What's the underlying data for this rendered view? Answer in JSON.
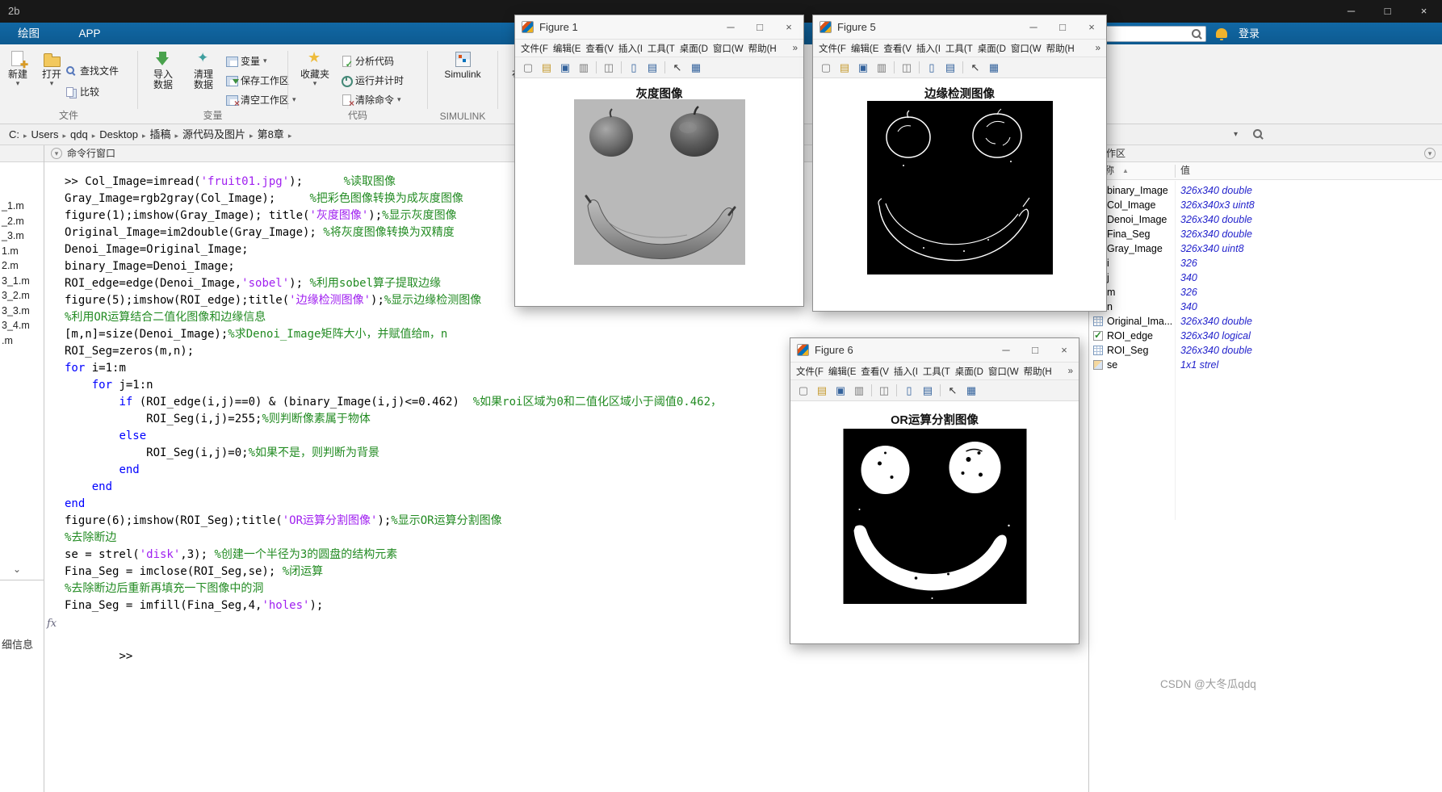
{
  "window": {
    "title": "2b"
  },
  "icons": {
    "minimize": "─",
    "maximize": "□",
    "close": "×",
    "dropdown": "▾",
    "crumb_arrow": "▸",
    "overflow": "»",
    "sort": "▲",
    "collapse": "⌄",
    "fx": "fx",
    "search": "magnifier-css-shape",
    "bell": "bell-css-shape"
  },
  "ribbon_tabs": [
    "绘图",
    "APP"
  ],
  "top_right": {
    "login": "登录"
  },
  "toolstrip": {
    "sections": [
      "文件",
      "变量",
      "代码",
      "SIMULINK"
    ],
    "buttons": {
      "new": "新建",
      "open": "打开",
      "find_files": "查找文件",
      "compare": "比较",
      "import_data": "导入数据",
      "clean_data": "清理数据",
      "variable": "变量",
      "save_workspace": "保存工作区",
      "clear_workspace": "清空工作区",
      "favorites": "收藏夹",
      "analyze_code": "分析代码",
      "run_and_time": "运行并计时",
      "clear_commands": "清除命令",
      "simulink": "Simulink",
      "layout": "布局"
    }
  },
  "addressbar": {
    "crumbs": [
      "C:",
      "Users",
      "qdq",
      "Desktop",
      "插稿",
      "源代码及图片",
      "第8章"
    ]
  },
  "left_panel": {
    "files": [
      "_1.m",
      "_2.m",
      "_3.m",
      "1.m",
      "2.m",
      "3_1.m",
      "3_2.m",
      "3_3.m",
      "3_4.m",
      ".m"
    ],
    "details": "细信息"
  },
  "command_window": {
    "title": "命令行窗口",
    "prompt": ">>",
    "lines": [
      [
        [
          "p",
          ">> Col_Image=imread("
        ],
        [
          "s",
          "'fruit01.jpg'"
        ],
        [
          "p",
          ");      "
        ],
        [
          "c",
          "%读取图像"
        ]
      ],
      [
        [
          "p",
          "Gray_Image=rgb2gray(Col_Image);     "
        ],
        [
          "c",
          "%把彩色图像转换为成灰度图像"
        ]
      ],
      [
        [
          "p",
          "figure(1);imshow(Gray_Image); title("
        ],
        [
          "s",
          "'灰度图像'"
        ],
        [
          "p",
          ");"
        ],
        [
          "c",
          "%显示灰度图像"
        ]
      ],
      [
        [
          "p",
          "Original_Image=im2double(Gray_Image); "
        ],
        [
          "c",
          "%将灰度图像转换为双精度"
        ]
      ],
      [
        [
          "p",
          "Denoi_Image=Original_Image;"
        ]
      ],
      [
        [
          "p",
          "binary_Image=Denoi_Image;"
        ]
      ],
      [
        [
          "p",
          "ROI_edge=edge(Denoi_Image,"
        ],
        [
          "s",
          "'sobel'"
        ],
        [
          "p",
          "); "
        ],
        [
          "c",
          "%利用sobel算子提取边缘"
        ]
      ],
      [
        [
          "p",
          "figure(5);imshow(ROI_edge);title("
        ],
        [
          "s",
          "'边缘检测图像'"
        ],
        [
          "p",
          ");"
        ],
        [
          "c",
          "%显示边缘检测图像"
        ]
      ],
      [
        [
          "c",
          "%利用OR运算结合二值化图像和边缘信息"
        ]
      ],
      [
        [
          "p",
          "[m,n]=size(Denoi_Image);"
        ],
        [
          "c",
          "%求Denoi_Image矩阵大小，并赋值给m，n"
        ]
      ],
      [
        [
          "p",
          "ROI_Seg=zeros(m,n);"
        ]
      ],
      [
        [
          "k",
          "for"
        ],
        [
          "p",
          " i=1:m"
        ]
      ],
      [
        [
          "p",
          "    "
        ],
        [
          "k",
          "for"
        ],
        [
          "p",
          " j=1:n"
        ]
      ],
      [
        [
          "p",
          "        "
        ],
        [
          "k",
          "if"
        ],
        [
          "p",
          " (ROI_edge(i,j)==0) & (binary_Image(i,j)<=0.462)  "
        ],
        [
          "c",
          "%如果roi区域为0和二值化区域小于阈值0.462，"
        ]
      ],
      [
        [
          "p",
          "            ROI_Seg(i,j)=255;"
        ],
        [
          "c",
          "%则判断像素属于物体"
        ]
      ],
      [
        [
          "p",
          "        "
        ],
        [
          "k",
          "else"
        ]
      ],
      [
        [
          "p",
          "            ROI_Seg(i,j)=0;"
        ],
        [
          "c",
          "%如果不是，则判断为背景"
        ]
      ],
      [
        [
          "p",
          "        "
        ],
        [
          "k",
          "end"
        ]
      ],
      [
        [
          "p",
          "    "
        ],
        [
          "k",
          "end"
        ]
      ],
      [
        [
          "k",
          "end"
        ]
      ],
      [
        [
          "p",
          "figure(6);imshow(ROI_Seg);title("
        ],
        [
          "s",
          "'OR运算分割图像'"
        ],
        [
          "p",
          ");"
        ],
        [
          "c",
          "%显示OR运算分割图像"
        ]
      ],
      [
        [
          "c",
          "%去除断边"
        ]
      ],
      [
        [
          "p",
          "se = strel("
        ],
        [
          "s",
          "'disk'"
        ],
        [
          "p",
          ",3); "
        ],
        [
          "c",
          "%创建一个半径为3的圆盘的结构元素"
        ]
      ],
      [
        [
          "p",
          "Fina_Seg = imclose(ROI_Seg,se); "
        ],
        [
          "c",
          "%闭运算"
        ]
      ],
      [
        [
          "c",
          "%去除断边后重新再填充一下图像中的洞"
        ]
      ],
      [
        [
          "p",
          "Fina_Seg = imfill(Fina_Seg,4,"
        ],
        [
          "s",
          "'holes'"
        ],
        [
          "p",
          ");"
        ]
      ]
    ]
  },
  "workspace": {
    "title": "工作区",
    "col_name": "名称",
    "col_value": "值",
    "rows": [
      {
        "name": "binary_Image",
        "value": "326x340 double",
        "icon": "grid"
      },
      {
        "name": "Col_Image",
        "value": "326x340x3 uint8",
        "icon": "grid"
      },
      {
        "name": "Denoi_Image",
        "value": "326x340 double",
        "icon": "grid"
      },
      {
        "name": "Fina_Seg",
        "value": "326x340 double",
        "icon": "grid"
      },
      {
        "name": "Gray_Image",
        "value": "326x340 uint8",
        "icon": "grid"
      },
      {
        "name": "i",
        "value": "326",
        "icon": "grid"
      },
      {
        "name": "j",
        "value": "340",
        "icon": "grid"
      },
      {
        "name": "m",
        "value": "326",
        "icon": "grid"
      },
      {
        "name": "n",
        "value": "340",
        "icon": "grid"
      },
      {
        "name": "Original_Ima...",
        "value": "326x340 double",
        "icon": "grid"
      },
      {
        "name": "ROI_edge",
        "value": "326x340 logical",
        "icon": "check"
      },
      {
        "name": "ROI_Seg",
        "value": "326x340 double",
        "icon": "grid"
      },
      {
        "name": "se",
        "value": "1x1 strel",
        "icon": "object"
      }
    ]
  },
  "figure_menu": {
    "items": [
      "文件(F",
      "编辑(E",
      "查看(V",
      "插入(I",
      "工具(T",
      "桌面(D",
      "窗口(W",
      "帮助(H"
    ],
    "overflow": "»"
  },
  "figure_toolbar": [
    "new-doc",
    "open",
    "save",
    "print",
    "sep",
    "snapshot",
    "sep",
    "colorbar",
    "legend",
    "sep",
    "pointer",
    "databrush"
  ],
  "figures": {
    "fig1": {
      "title": "Figure 1",
      "plot_title": "灰度图像"
    },
    "fig5": {
      "title": "Figure 5",
      "plot_title": "边缘检测图像"
    },
    "fig6": {
      "title": "Figure 6",
      "plot_title": "OR运算分割图像"
    }
  },
  "watermark": "CSDN @大冬瓜qdq"
}
